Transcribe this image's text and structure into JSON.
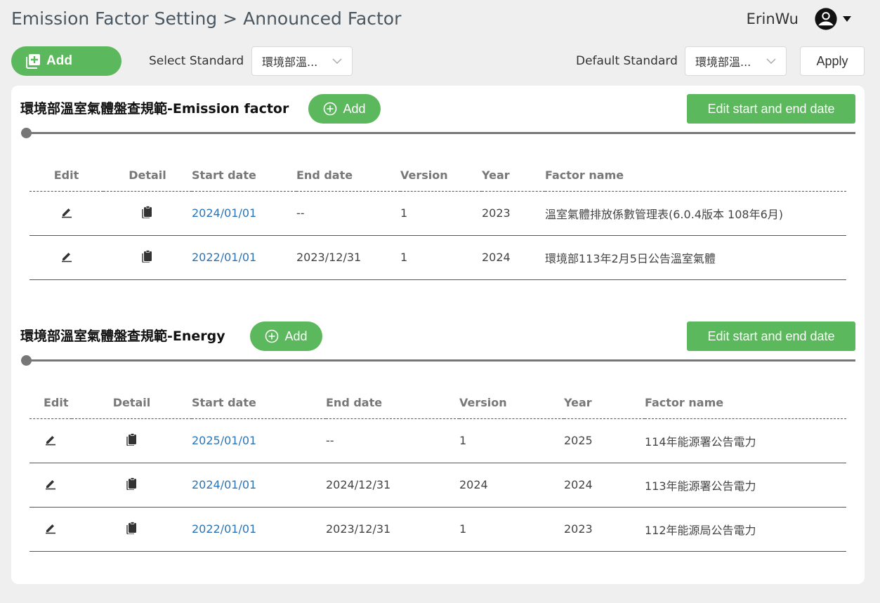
{
  "header": {
    "breadcrumb": [
      "Emission Factor Setting",
      "Announced Factor"
    ],
    "breadcrumb_separator": ">",
    "user_name": "ErinWu"
  },
  "toolbar": {
    "add_label": "Add",
    "select_standard_label": "Select Standard",
    "select_standard_value": "環境部溫...",
    "default_standard_label": "Default Standard",
    "default_standard_value": "環境部溫...",
    "apply_label": "Apply"
  },
  "colors": {
    "accent": "#5cb85c",
    "link": "#2b74b5"
  },
  "sections": [
    {
      "title": "環境部溫室氣體盤查規範-Emission factor",
      "add_label": "Add",
      "edit_dates_label": "Edit start and end date",
      "columns": [
        "Edit",
        "Detail",
        "Start date",
        "End date",
        "Version",
        "Year",
        "Factor name"
      ],
      "rows": [
        {
          "start": "2024/01/01",
          "end": "--",
          "version": "1",
          "year": "2023",
          "name": "溫室氣體排放係數管理表(6.0.4版本 108年6月)"
        },
        {
          "start": "2022/01/01",
          "end": "2023/12/31",
          "version": "1",
          "year": "2024",
          "name": "環境部113年2月5日公告溫室氣體"
        }
      ]
    },
    {
      "title": "環境部溫室氣體盤查規範-Energy",
      "add_label": "Add",
      "edit_dates_label": "Edit start and end date",
      "columns": [
        "Edit",
        "Detail",
        "Start date",
        "End date",
        "Version",
        "Year",
        "Factor name"
      ],
      "rows": [
        {
          "start": "2025/01/01",
          "end": "--",
          "version": "1",
          "year": "2025",
          "name": "114年能源署公告電力"
        },
        {
          "start": "2024/01/01",
          "end": "2024/12/31",
          "version": "2024",
          "year": "2024",
          "name": "113年能源署公告電力"
        },
        {
          "start": "2022/01/01",
          "end": "2023/12/31",
          "version": "1",
          "year": "2023",
          "name": "112年能源局公告電力"
        }
      ]
    }
  ],
  "icons": {
    "toolbar_add": "add-box-icon",
    "section_add": "plus-circle-icon",
    "edit": "pencil-icon",
    "detail": "clipboard-icon",
    "user": "user-circle-icon",
    "dropdown": "caret-down-icon",
    "select_chevron": "chevron-down-icon"
  }
}
